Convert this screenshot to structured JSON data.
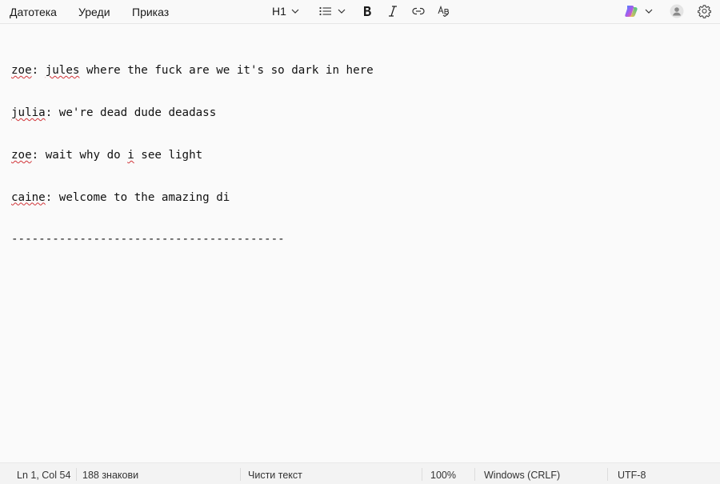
{
  "menubar": {
    "file": "Датотека",
    "edit": "Уреди",
    "view": "Приказ"
  },
  "toolbar": {
    "heading_label": "H1"
  },
  "editor": {
    "lines": [
      {
        "speaker": "zoe",
        "text": ": ",
        "marked": "jules",
        "rest": " where the fuck are we it's so dark in here"
      },
      {
        "speaker": "julia",
        "text": ": we're dead dude deadass"
      },
      {
        "speaker": "zoe",
        "text": ": wait why do ",
        "marked": "i",
        "rest": " see light"
      },
      {
        "speaker": "caine",
        "text": ": welcome to the amazing di"
      },
      {
        "plain": "----------------------------------------"
      }
    ]
  },
  "statusbar": {
    "position": "Ln 1, Col 54",
    "chars": "188 знакови",
    "format": "Чисти текст",
    "zoom": "100%",
    "line_ending": "Windows (CRLF)",
    "encoding": "UTF-8"
  },
  "colors": {
    "background": "#fafafa",
    "spellcheck": "#d13438"
  }
}
